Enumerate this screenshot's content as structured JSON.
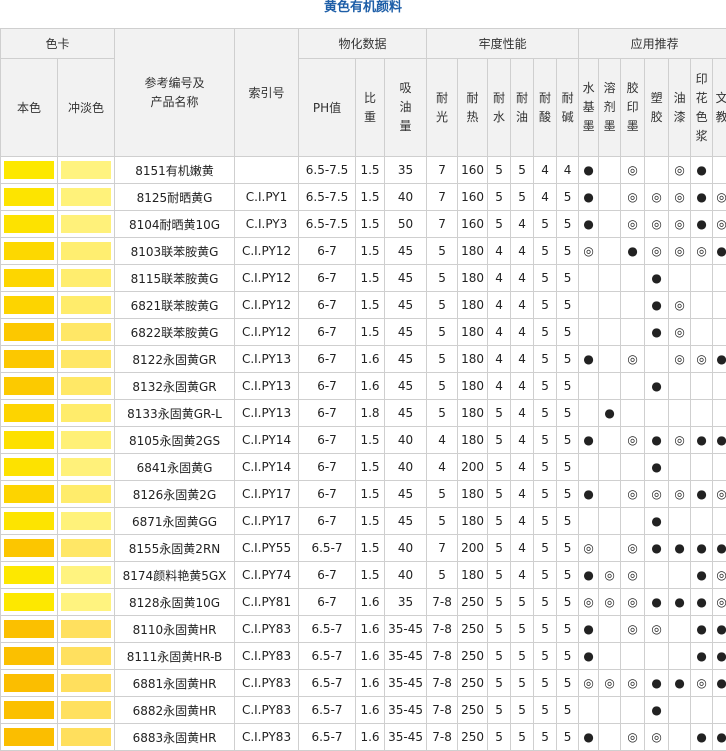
{
  "title": "黄色有机颜料",
  "headers": {
    "color_card": "色卡",
    "base_color": "本色",
    "tint_color": "冲淡色",
    "product": "参考编号及产品名称",
    "index": "索引号",
    "physchem": "物化数据",
    "ph": "PH值",
    "density": "比重",
    "oil_absorption": "吸油量",
    "fastness": "牢度性能",
    "light": "耐光",
    "heat": "耐热",
    "water": "耐水",
    "oil": "耐油",
    "acid": "耐酸",
    "alkali": "耐碱",
    "applications": "应用推荐",
    "water_ink": "水基墨",
    "solvent_ink": "溶剂墨",
    "offset_ink": "胶印墨",
    "plastic": "塑胶",
    "paint": "油漆",
    "print_paste": "印花色浆",
    "stationery": "文教"
  },
  "rows": [
    {
      "base": "#fde800",
      "tint": "#fff37f",
      "name": "8151有机嫩黄",
      "index": "",
      "ph": "6.5-7.5",
      "density": "1.5",
      "oil": "35",
      "light": "7",
      "heat": "160",
      "water": "5",
      "oilr": "5",
      "acid": "4",
      "alkali": "4",
      "apps": [
        "●",
        "",
        "◎",
        "",
        "◎",
        "●",
        ""
      ]
    },
    {
      "base": "#fde400",
      "tint": "#fff27a",
      "name": "8125耐晒黄G",
      "index": "C.I.PY1",
      "ph": "6.5-7.5",
      "density": "1.5",
      "oil": "40",
      "light": "7",
      "heat": "160",
      "water": "5",
      "oilr": "5",
      "acid": "4",
      "alkali": "5",
      "apps": [
        "●",
        "",
        "◎",
        "◎",
        "◎",
        "●",
        "◎"
      ]
    },
    {
      "base": "#fde200",
      "tint": "#fff17a",
      "name": "8104耐晒黄10G",
      "index": "C.I.PY3",
      "ph": "6.5-7.5",
      "density": "1.5",
      "oil": "50",
      "light": "7",
      "heat": "160",
      "water": "5",
      "oilr": "4",
      "acid": "5",
      "alkali": "5",
      "apps": [
        "●",
        "",
        "◎",
        "◎",
        "◎",
        "●",
        "◎"
      ]
    },
    {
      "base": "#fdd800",
      "tint": "#ffee70",
      "name": "8103联苯胺黄G",
      "index": "C.I.PY12",
      "ph": "6-7",
      "density": "1.5",
      "oil": "45",
      "light": "5",
      "heat": "180",
      "water": "4",
      "oilr": "4",
      "acid": "5",
      "alkali": "5",
      "apps": [
        "◎",
        "",
        "●",
        "◎",
        "◎",
        "◎",
        "●"
      ]
    },
    {
      "base": "#fdd600",
      "tint": "#ffed6e",
      "name": "8115联苯胺黄G",
      "index": "C.I.PY12",
      "ph": "6-7",
      "density": "1.5",
      "oil": "45",
      "light": "5",
      "heat": "180",
      "water": "4",
      "oilr": "4",
      "acid": "5",
      "alkali": "5",
      "apps": [
        "",
        "",
        "",
        "●",
        "",
        "",
        ""
      ]
    },
    {
      "base": "#fdd400",
      "tint": "#ffec6b",
      "name": "6821联苯胺黄G",
      "index": "C.I.PY12",
      "ph": "6-7",
      "density": "1.5",
      "oil": "45",
      "light": "5",
      "heat": "180",
      "water": "4",
      "oilr": "4",
      "acid": "5",
      "alkali": "5",
      "apps": [
        "",
        "",
        "",
        "●",
        "◎",
        "",
        ""
      ]
    },
    {
      "base": "#fcc800",
      "tint": "#ffe766",
      "name": "6822联苯胺黄G",
      "index": "C.I.PY12",
      "ph": "6-7",
      "density": "1.5",
      "oil": "45",
      "light": "5",
      "heat": "180",
      "water": "4",
      "oilr": "4",
      "acid": "5",
      "alkali": "5",
      "apps": [
        "",
        "",
        "",
        "●",
        "◎",
        "",
        ""
      ]
    },
    {
      "base": "#fcc800",
      "tint": "#ffe766",
      "name": "8122永固黄GR",
      "index": "C.I.PY13",
      "ph": "6-7",
      "density": "1.6",
      "oil": "45",
      "light": "5",
      "heat": "180",
      "water": "4",
      "oilr": "4",
      "acid": "5",
      "alkali": "5",
      "apps": [
        "●",
        "",
        "◎",
        "",
        "◎",
        "◎",
        "●"
      ]
    },
    {
      "base": "#fcca00",
      "tint": "#ffe866",
      "name": "8132永固黄GR",
      "index": "C.I.PY13",
      "ph": "6-7",
      "density": "1.6",
      "oil": "45",
      "light": "5",
      "heat": "180",
      "water": "4",
      "oilr": "4",
      "acid": "5",
      "alkali": "5",
      "apps": [
        "",
        "",
        "",
        "●",
        "",
        "",
        ""
      ]
    },
    {
      "base": "#fdd400",
      "tint": "#ffec6b",
      "name": "8133永固黄GR-L",
      "index": "C.I.PY13",
      "ph": "6-7",
      "density": "1.8",
      "oil": "45",
      "light": "5",
      "heat": "180",
      "water": "5",
      "oilr": "4",
      "acid": "5",
      "alkali": "5",
      "apps": [
        "",
        "●",
        "",
        "",
        "",
        "",
        ""
      ]
    },
    {
      "base": "#fde000",
      "tint": "#fff077",
      "name": "8105永固黄2GS",
      "index": "C.I.PY14",
      "ph": "6-7",
      "density": "1.5",
      "oil": "40",
      "light": "4",
      "heat": "180",
      "water": "5",
      "oilr": "4",
      "acid": "5",
      "alkali": "5",
      "apps": [
        "●",
        "",
        "◎",
        "●",
        "◎",
        "●",
        "●"
      ]
    },
    {
      "base": "#fde200",
      "tint": "#fff17a",
      "name": "6841永固黄G",
      "index": "C.I.PY14",
      "ph": "6-7",
      "density": "1.5",
      "oil": "40",
      "light": "4",
      "heat": "200",
      "water": "5",
      "oilr": "4",
      "acid": "5",
      "alkali": "5",
      "apps": [
        "",
        "",
        "",
        "●",
        "",
        "",
        ""
      ]
    },
    {
      "base": "#fdd400",
      "tint": "#ffec6b",
      "name": "8126永固黄2G",
      "index": "C.I.PY17",
      "ph": "6-7",
      "density": "1.5",
      "oil": "45",
      "light": "5",
      "heat": "180",
      "water": "5",
      "oilr": "4",
      "acid": "5",
      "alkali": "5",
      "apps": [
        "●",
        "",
        "◎",
        "◎",
        "◎",
        "●",
        "◎"
      ]
    },
    {
      "base": "#fde400",
      "tint": "#fff27a",
      "name": "6871永固黄GG",
      "index": "C.I.PY17",
      "ph": "6-7",
      "density": "1.5",
      "oil": "45",
      "light": "5",
      "heat": "180",
      "water": "5",
      "oilr": "4",
      "acid": "5",
      "alkali": "5",
      "apps": [
        "",
        "",
        "",
        "●",
        "",
        "",
        ""
      ]
    },
    {
      "base": "#fcc600",
      "tint": "#ffe766",
      "name": "8155永固黄2RN",
      "index": "C.I.PY55",
      "ph": "6.5-7",
      "density": "1.5",
      "oil": "40",
      "light": "7",
      "heat": "200",
      "water": "5",
      "oilr": "4",
      "acid": "5",
      "alkali": "5",
      "apps": [
        "◎",
        "",
        "◎",
        "●",
        "●",
        "●",
        "●"
      ]
    },
    {
      "base": "#fde800",
      "tint": "#fff37f",
      "name": "8174颜料艳黄5GX",
      "index": "C.I.PY74",
      "ph": "6-7",
      "density": "1.5",
      "oil": "40",
      "light": "5",
      "heat": "180",
      "water": "5",
      "oilr": "4",
      "acid": "5",
      "alkali": "5",
      "apps": [
        "●",
        "◎",
        "◎",
        "",
        "",
        "●",
        "◎"
      ]
    },
    {
      "base": "#fde800",
      "tint": "#fff37f",
      "name": "8128永固黄10G",
      "index": "C.I.PY81",
      "ph": "6-7",
      "density": "1.6",
      "oil": "35",
      "light": "7-8",
      "heat": "250",
      "water": "5",
      "oilr": "5",
      "acid": "5",
      "alkali": "5",
      "apps": [
        "◎",
        "◎",
        "◎",
        "●",
        "●",
        "●",
        "◎"
      ]
    },
    {
      "base": "#fbc000",
      "tint": "#ffe05f",
      "name": "8110永固黄HR",
      "index": "C.I.PY83",
      "ph": "6.5-7",
      "density": "1.6",
      "oil": "35-45",
      "light": "7-8",
      "heat": "250",
      "water": "5",
      "oilr": "5",
      "acid": "5",
      "alkali": "5",
      "apps": [
        "●",
        "",
        "◎",
        "◎",
        "",
        "●",
        "●"
      ]
    },
    {
      "base": "#fbc000",
      "tint": "#ffe05f",
      "name": "8111永固黄HR-B",
      "index": "C.I.PY83",
      "ph": "6.5-7",
      "density": "1.6",
      "oil": "35-45",
      "light": "7-8",
      "heat": "250",
      "water": "5",
      "oilr": "5",
      "acid": "5",
      "alkali": "5",
      "apps": [
        "●",
        "",
        "",
        "",
        "",
        "●",
        "●"
      ]
    },
    {
      "base": "#fbbe00",
      "tint": "#ffdf5d",
      "name": "6881永固黄HR",
      "index": "C.I.PY83",
      "ph": "6.5-7",
      "density": "1.6",
      "oil": "35-45",
      "light": "7-8",
      "heat": "250",
      "water": "5",
      "oilr": "5",
      "acid": "5",
      "alkali": "5",
      "apps": [
        "◎",
        "◎",
        "◎",
        "●",
        "●",
        "◎",
        "●"
      ]
    },
    {
      "base": "#fbc000",
      "tint": "#ffe05f",
      "name": "6882永固黄HR",
      "index": "C.I.PY83",
      "ph": "6.5-7",
      "density": "1.6",
      "oil": "35-45",
      "light": "7-8",
      "heat": "250",
      "water": "5",
      "oilr": "5",
      "acid": "5",
      "alkali": "5",
      "apps": [
        "",
        "",
        "",
        "●",
        "",
        "",
        ""
      ]
    },
    {
      "base": "#fbbe00",
      "tint": "#ffdf5d",
      "name": "6883永固黄HR",
      "index": "C.I.PY83",
      "ph": "6.5-7",
      "density": "1.6",
      "oil": "35-45",
      "light": "7-8",
      "heat": "250",
      "water": "5",
      "oilr": "5",
      "acid": "5",
      "alkali": "5",
      "apps": [
        "●",
        "",
        "◎",
        "◎",
        "",
        "●",
        "●"
      ]
    }
  ]
}
